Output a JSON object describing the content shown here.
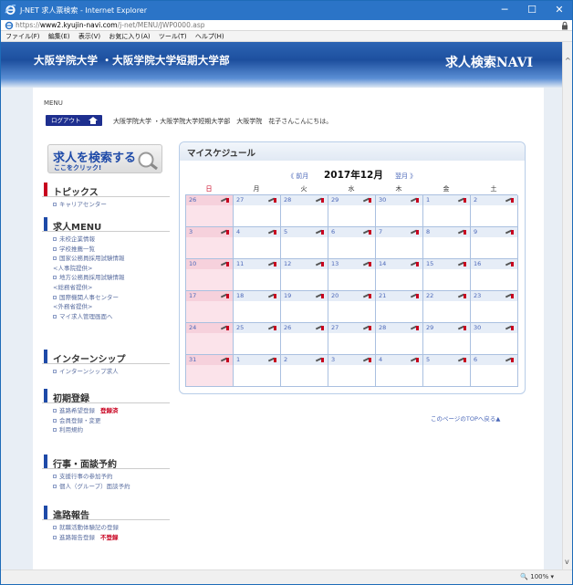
{
  "window": {
    "title": "J-NET 求人票検索 - Internet Explorer",
    "buttons": {
      "minimize": "─",
      "maximize": "☐",
      "close": "✕"
    }
  },
  "address": {
    "scheme": "https://",
    "host": "www2.kyujin-navi.com",
    "path": "/j-net/MENU/JWP0000.asp"
  },
  "menubar": [
    "ファイル(F)",
    "編集(E)",
    "表示(V)",
    "お気に入り(A)",
    "ツール(T)",
    "ヘルプ(H)"
  ],
  "banner": {
    "university": "大阪学院大学 ・大阪学院大学短期大学部",
    "service": "求人検索NAVI"
  },
  "header": {
    "menu_label": "MENU",
    "logout_label": "ログアウト",
    "greeting": "大阪学院大学 ・大阪学院大学短期大学部　大阪学院　花子さんこんにちは。"
  },
  "search_button": {
    "title": "求人を検索する",
    "subtitle": "ここをクリック!"
  },
  "sidebar": {
    "topics": {
      "title": "トピックス",
      "color": "#c8001f",
      "items": [
        {
          "label": "キャリアセンター"
        }
      ]
    },
    "kyujin": {
      "title": "求人MENU",
      "color": "#1e4aa8",
      "items": [
        {
          "label": "未校企業情報"
        },
        {
          "label": "学校推薦一覧"
        },
        {
          "label": "国家公務員採用試験情報",
          "cont": "<人事院提供>"
        },
        {
          "label": "地方公務員採用試験情報",
          "cont": "<総務省提供>"
        },
        {
          "label": "国際機関人事センター",
          "cont": "<外務省提供>"
        },
        {
          "label": "マイ求人管理画面へ"
        }
      ]
    },
    "intern": {
      "title": "インターンシップ",
      "color": "#1e4aa8",
      "items": [
        {
          "label": "インターンシップ求人"
        }
      ]
    },
    "shoki": {
      "title": "初期登録",
      "color": "#1e4aa8",
      "items": [
        {
          "label": "進路希望登録",
          "flag": "登録済"
        },
        {
          "label": "会員登録・変更"
        },
        {
          "label": "利用規約"
        }
      ]
    },
    "gyoji": {
      "title": "行事・面談予約",
      "color": "#1e4aa8",
      "items": [
        {
          "label": "支援行事の参加予約"
        },
        {
          "label": "個人（グループ）面談予約"
        }
      ]
    },
    "shinro": {
      "title": "進路報告",
      "color": "#1e4aa8",
      "items": [
        {
          "label": "就職活動体験記の登録"
        },
        {
          "label": "進路報告登録",
          "flag": "不登録"
        }
      ]
    }
  },
  "schedule": {
    "title": "マイスケジュール",
    "prev": "《 前月",
    "month": "2017年12月",
    "next": "翌月 》",
    "weekdays": [
      "日",
      "月",
      "火",
      "水",
      "木",
      "金",
      "土"
    ],
    "weeks": [
      [
        "26",
        "27",
        "28",
        "29",
        "30",
        "1",
        "2"
      ],
      [
        "3",
        "4",
        "5",
        "6",
        "7",
        "8",
        "9"
      ],
      [
        "10",
        "11",
        "12",
        "13",
        "14",
        "15",
        "16"
      ],
      [
        "17",
        "18",
        "19",
        "20",
        "21",
        "22",
        "23"
      ],
      [
        "24",
        "25",
        "26",
        "27",
        "28",
        "29",
        "30"
      ],
      [
        "31",
        "1",
        "2",
        "3",
        "4",
        "5",
        "6"
      ]
    ]
  },
  "totop": "このページのTOPへ戻る▲",
  "status": {
    "zoom": "🔍 100%  ▾"
  }
}
